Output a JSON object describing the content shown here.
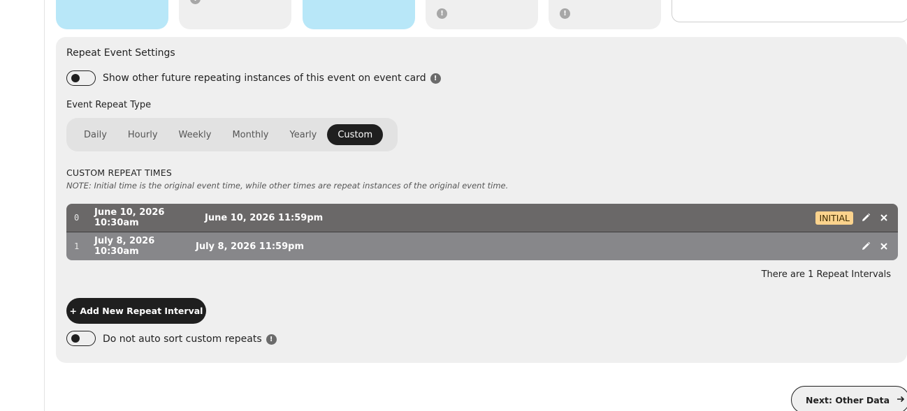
{
  "top_cards": [
    {
      "name": "card-1",
      "color": "#b8e7f8"
    },
    {
      "name": "card-2",
      "color": "#efefef"
    },
    {
      "name": "card-3",
      "color": "#b8e7f8"
    },
    {
      "name": "card-4",
      "color": "#efefef"
    },
    {
      "name": "card-5",
      "color": "#efefef"
    }
  ],
  "info_glyph": "!",
  "panel": {
    "title": "Repeat Event Settings",
    "show_future_toggle_label": "Show other future repeating instances of this event on event card",
    "repeat_type_label": "Event Repeat Type",
    "repeat_types": [
      "Daily",
      "Hourly",
      "Weekly",
      "Monthly",
      "Yearly",
      "Custom"
    ],
    "selected_repeat_type": "Custom",
    "custom_title": "CUSTOM REPEAT TIMES",
    "custom_note": "NOTE: Initial time is the original event time, while other times are repeat instances of the original event time.",
    "rows": [
      {
        "index": "0",
        "start": "June 10, 2026 10:30am",
        "end": "June 10, 2026 11:59pm",
        "badge": "INITIAL"
      },
      {
        "index": "1",
        "start": "July 8, 2026 10:30am",
        "end": "July 8, 2026 11:59pm"
      }
    ],
    "interval_count_text": "There are 1 Repeat Intervals",
    "add_button_label": "+ Add New Repeat Interval",
    "no_sort_toggle_label": "Do not auto sort custom repeats"
  },
  "footer": {
    "next_button_label": "Next: Other Data",
    "next_icon": "arrow-right-icon"
  },
  "colors": {
    "accent_dark": "#1f1f1f",
    "initial_badge": "#fbd38d",
    "row_primary": "#6a6868",
    "row_secondary": "#87878a",
    "card_blue": "#b8e7f8"
  }
}
